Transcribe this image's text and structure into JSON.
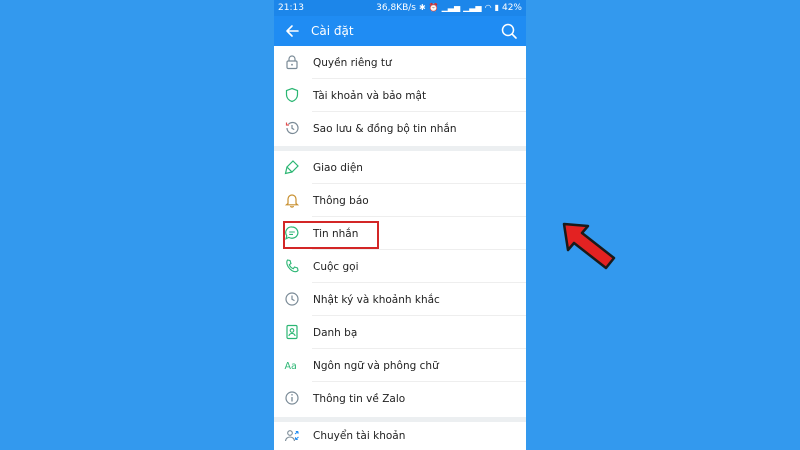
{
  "status_bar": {
    "time": "21:13",
    "network_speed": "36,8KB/s",
    "battery": "42%"
  },
  "app_bar": {
    "title": "Cài đặt"
  },
  "groups": [
    {
      "items": [
        {
          "label": "Quyền riêng tư",
          "icon": "lock-icon"
        },
        {
          "label": "Tài khoản và bảo mật",
          "icon": "shield-icon"
        },
        {
          "label": "Sao lưu & đồng bộ tin nhắn",
          "icon": "history-icon"
        }
      ]
    },
    {
      "items": [
        {
          "label": "Giao diện",
          "icon": "brush-icon"
        },
        {
          "label": "Thông báo",
          "icon": "bell-icon"
        },
        {
          "label": "Tin nhắn",
          "icon": "chat-icon"
        },
        {
          "label": "Cuộc gọi",
          "icon": "phone-icon"
        },
        {
          "label": "Nhật ký và khoảnh khắc",
          "icon": "clock-icon"
        },
        {
          "label": "Danh bạ",
          "icon": "contacts-icon"
        },
        {
          "label": "Ngôn ngữ và phông chữ",
          "icon": "language-icon"
        },
        {
          "label": "Thông tin về Zalo",
          "icon": "info-icon"
        }
      ]
    },
    {
      "items": [
        {
          "label": "Chuyển tài khoản",
          "icon": "switch-account-icon"
        }
      ]
    }
  ],
  "colors": {
    "background": "#3399ee",
    "app_bar": "#1f8cf3",
    "icon": "#7a8a96",
    "highlight": "#d32626",
    "arrow": "#e32222"
  }
}
